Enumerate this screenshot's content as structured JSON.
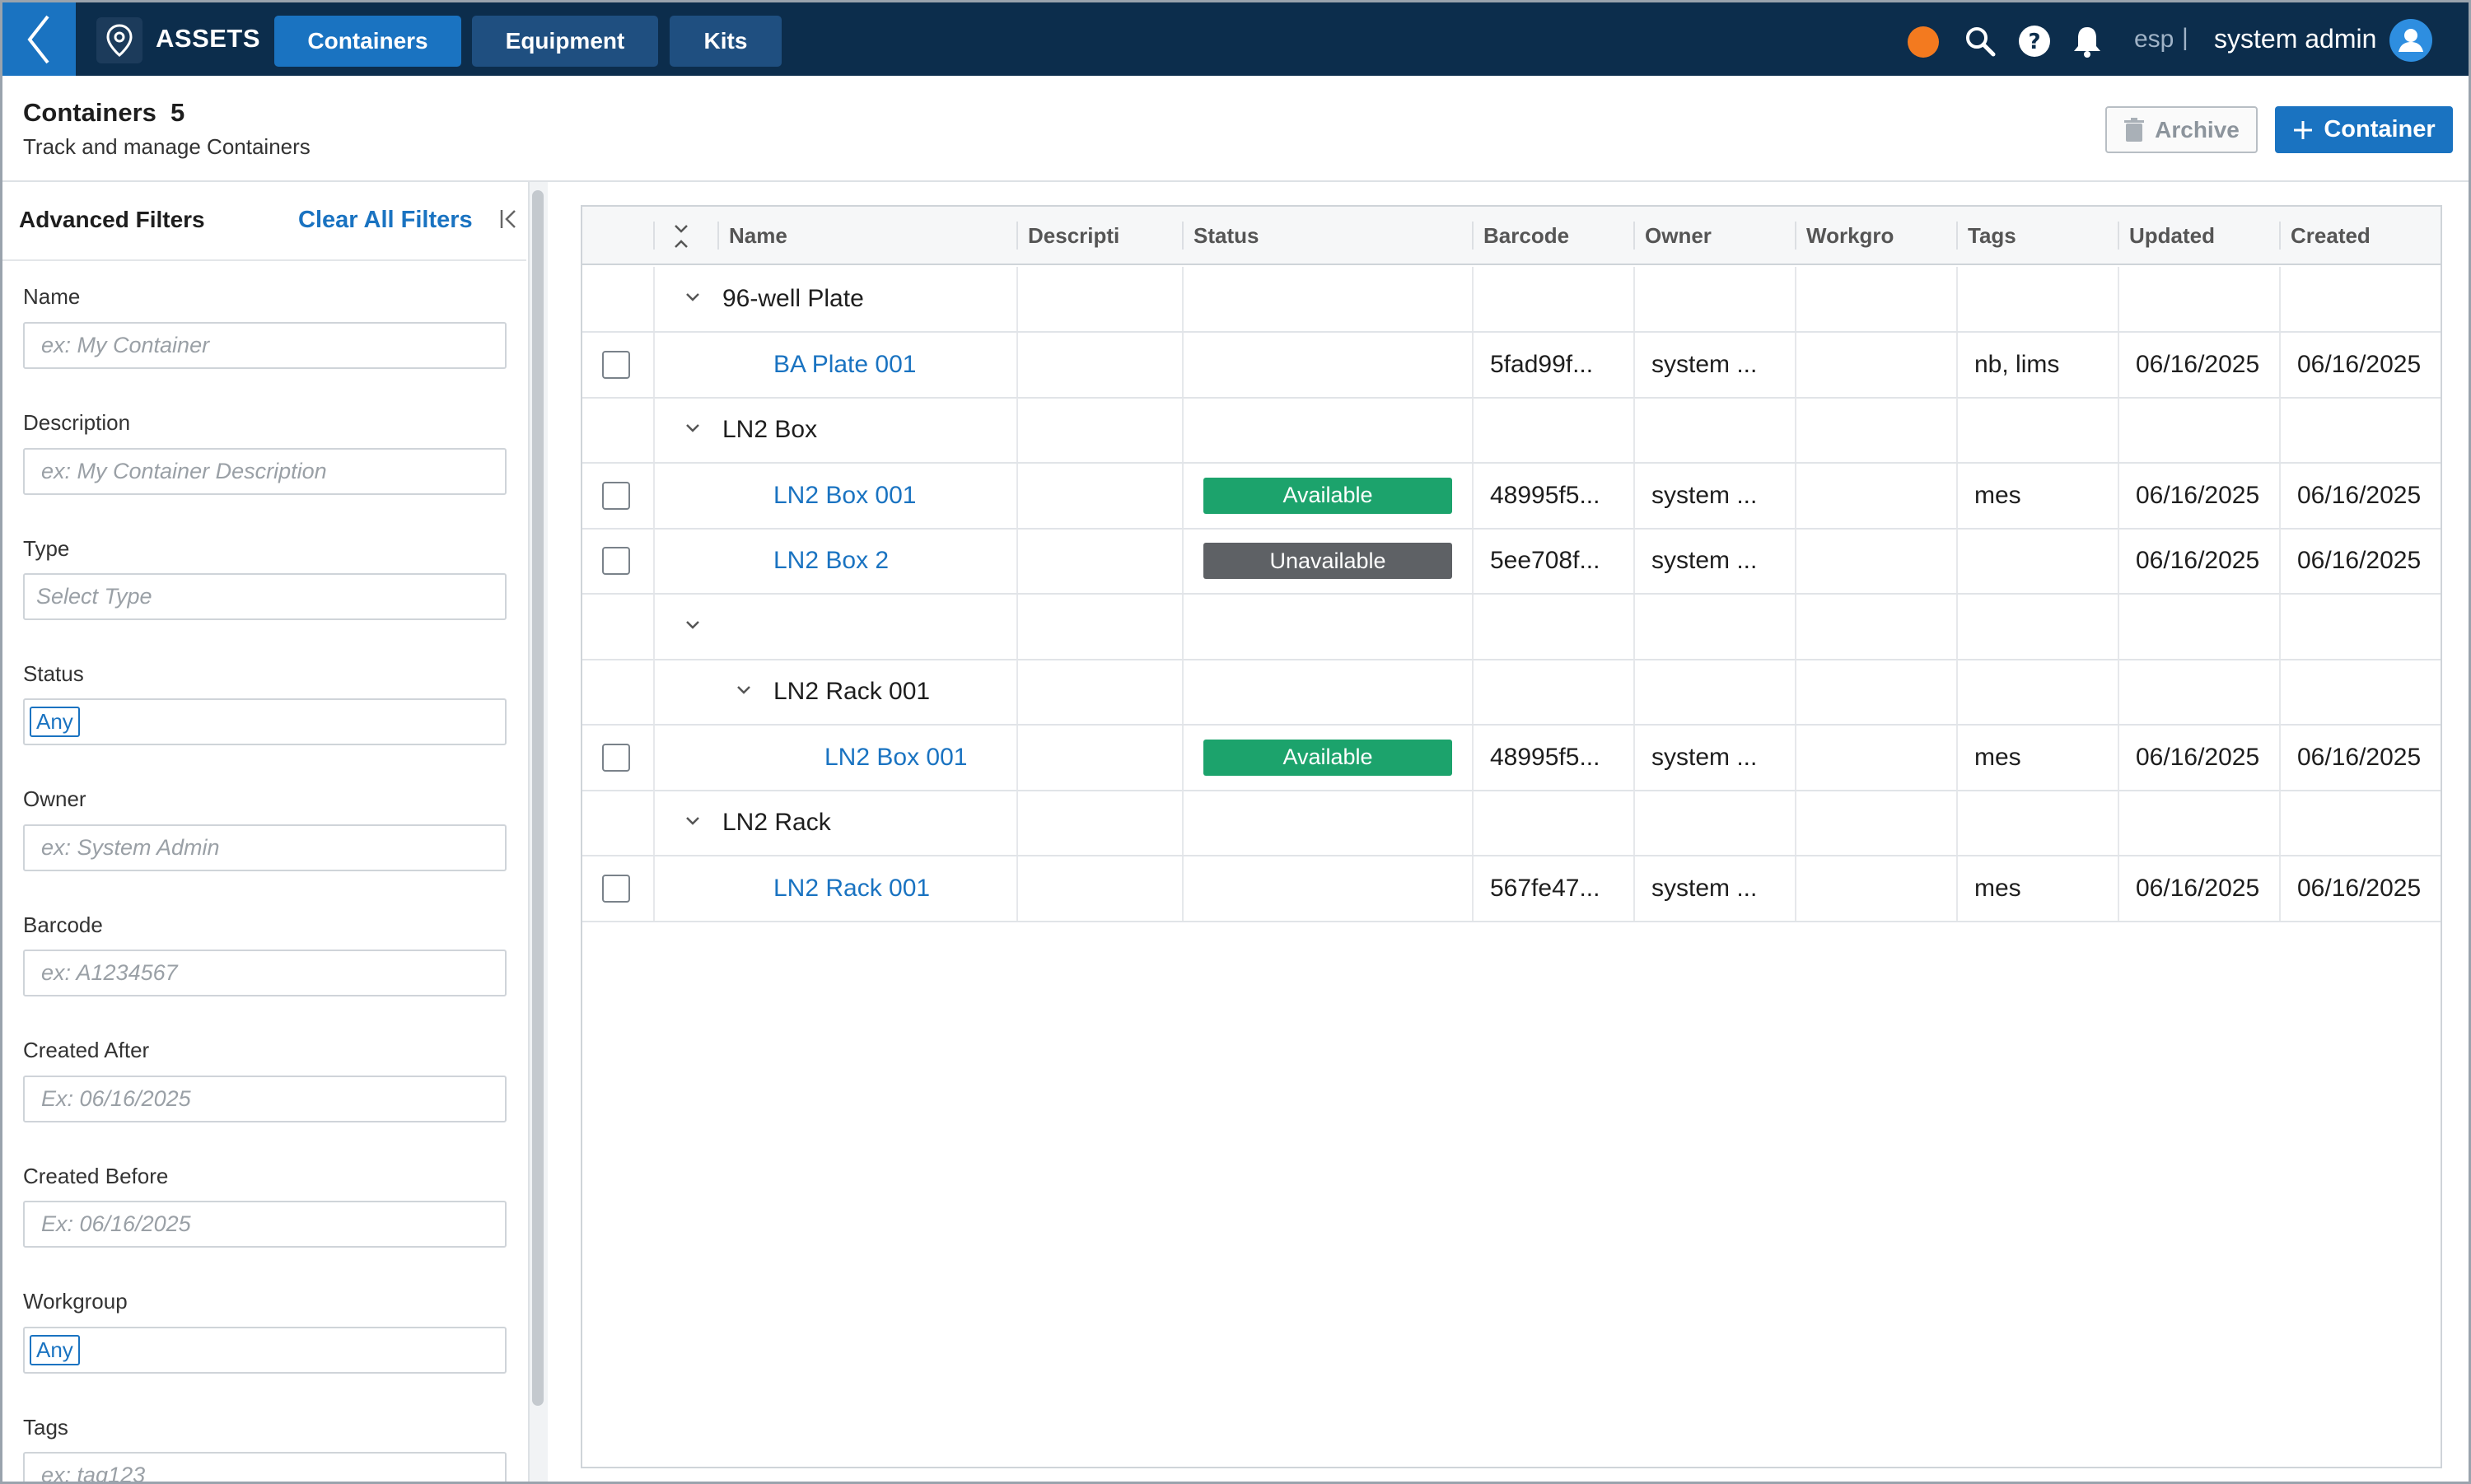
{
  "topbar": {
    "app_name": "ASSETS",
    "tabs": [
      {
        "label": "Containers",
        "active": true
      },
      {
        "label": "Equipment",
        "active": false
      },
      {
        "label": "Kits",
        "active": false
      }
    ],
    "status_dot_color": "#f37a1f",
    "lang": "esp",
    "lang_sep": "|",
    "user": "system admin",
    "icons": [
      "back-chevron-icon",
      "location-pin-icon",
      "search-icon",
      "help-icon",
      "bell-icon",
      "user-avatar-icon"
    ]
  },
  "page": {
    "title": "Containers",
    "count": "5",
    "subtitle": "Track and manage Containers",
    "archive_label": "Archive",
    "add_label": "Container"
  },
  "sidebar": {
    "title": "Advanced Filters",
    "clear_label": "Clear All Filters",
    "filters": [
      {
        "label": "Name",
        "placeholder": "ex: My Container"
      },
      {
        "label": "Description",
        "placeholder": "ex: My Container Description"
      },
      {
        "label": "Type",
        "placeholder": "Select Type"
      },
      {
        "label": "Status",
        "chip": "Any"
      },
      {
        "label": "Owner",
        "placeholder": "ex: System Admin"
      },
      {
        "label": "Barcode",
        "placeholder": "ex: A1234567"
      },
      {
        "label": "Created After",
        "placeholder": "Ex: 06/16/2025"
      },
      {
        "label": "Created Before",
        "placeholder": "Ex: 06/16/2025"
      },
      {
        "label": "Workgroup",
        "chip": "Any"
      },
      {
        "label": "Tags",
        "placeholder": "ex: tag123"
      }
    ]
  },
  "grid": {
    "columns": [
      "Name",
      "Descripti",
      "Status",
      "Barcode",
      "Owner",
      "Workgro",
      "Tags",
      "Updated",
      "Created"
    ],
    "rows": [
      {
        "kind": "group",
        "level": 0,
        "name": "96-well Plate"
      },
      {
        "kind": "item",
        "level": 0,
        "name": "BA Plate 001",
        "status": "",
        "barcode": "5fad99f...",
        "owner": "system ...",
        "tags": "nb, lims",
        "updated": "06/16/2025",
        "created": "06/16/2025"
      },
      {
        "kind": "group",
        "level": 0,
        "name": "LN2 Box"
      },
      {
        "kind": "item",
        "level": 0,
        "name": "LN2 Box 001",
        "status": "Available",
        "barcode": "48995f5...",
        "owner": "system ...",
        "tags": "mes",
        "updated": "06/16/2025",
        "created": "06/16/2025"
      },
      {
        "kind": "item",
        "level": 0,
        "name": "LN2 Box 2",
        "status": "Unavailable",
        "barcode": "5ee708f...",
        "owner": "system ...",
        "tags": "",
        "updated": "06/16/2025",
        "created": "06/16/2025"
      },
      {
        "kind": "group",
        "level": 0,
        "name": ""
      },
      {
        "kind": "group",
        "level": 1,
        "name": "LN2 Rack 001"
      },
      {
        "kind": "item",
        "level": 1,
        "name": "LN2 Box 001",
        "status": "Available",
        "barcode": "48995f5...",
        "owner": "system ...",
        "tags": "mes",
        "updated": "06/16/2025",
        "created": "06/16/2025"
      },
      {
        "kind": "group",
        "level": 0,
        "name": "LN2 Rack"
      },
      {
        "kind": "item",
        "level": 0,
        "name": "LN2 Rack 001",
        "status": "",
        "barcode": "567fe47...",
        "owner": "system ...",
        "tags": "mes",
        "updated": "06/16/2025",
        "created": "06/16/2025"
      }
    ]
  },
  "colors": {
    "nav_bg": "#0c2d4c",
    "accent": "#1a73c1",
    "available": "#1ca36c",
    "unavailable": "#5e6165"
  }
}
